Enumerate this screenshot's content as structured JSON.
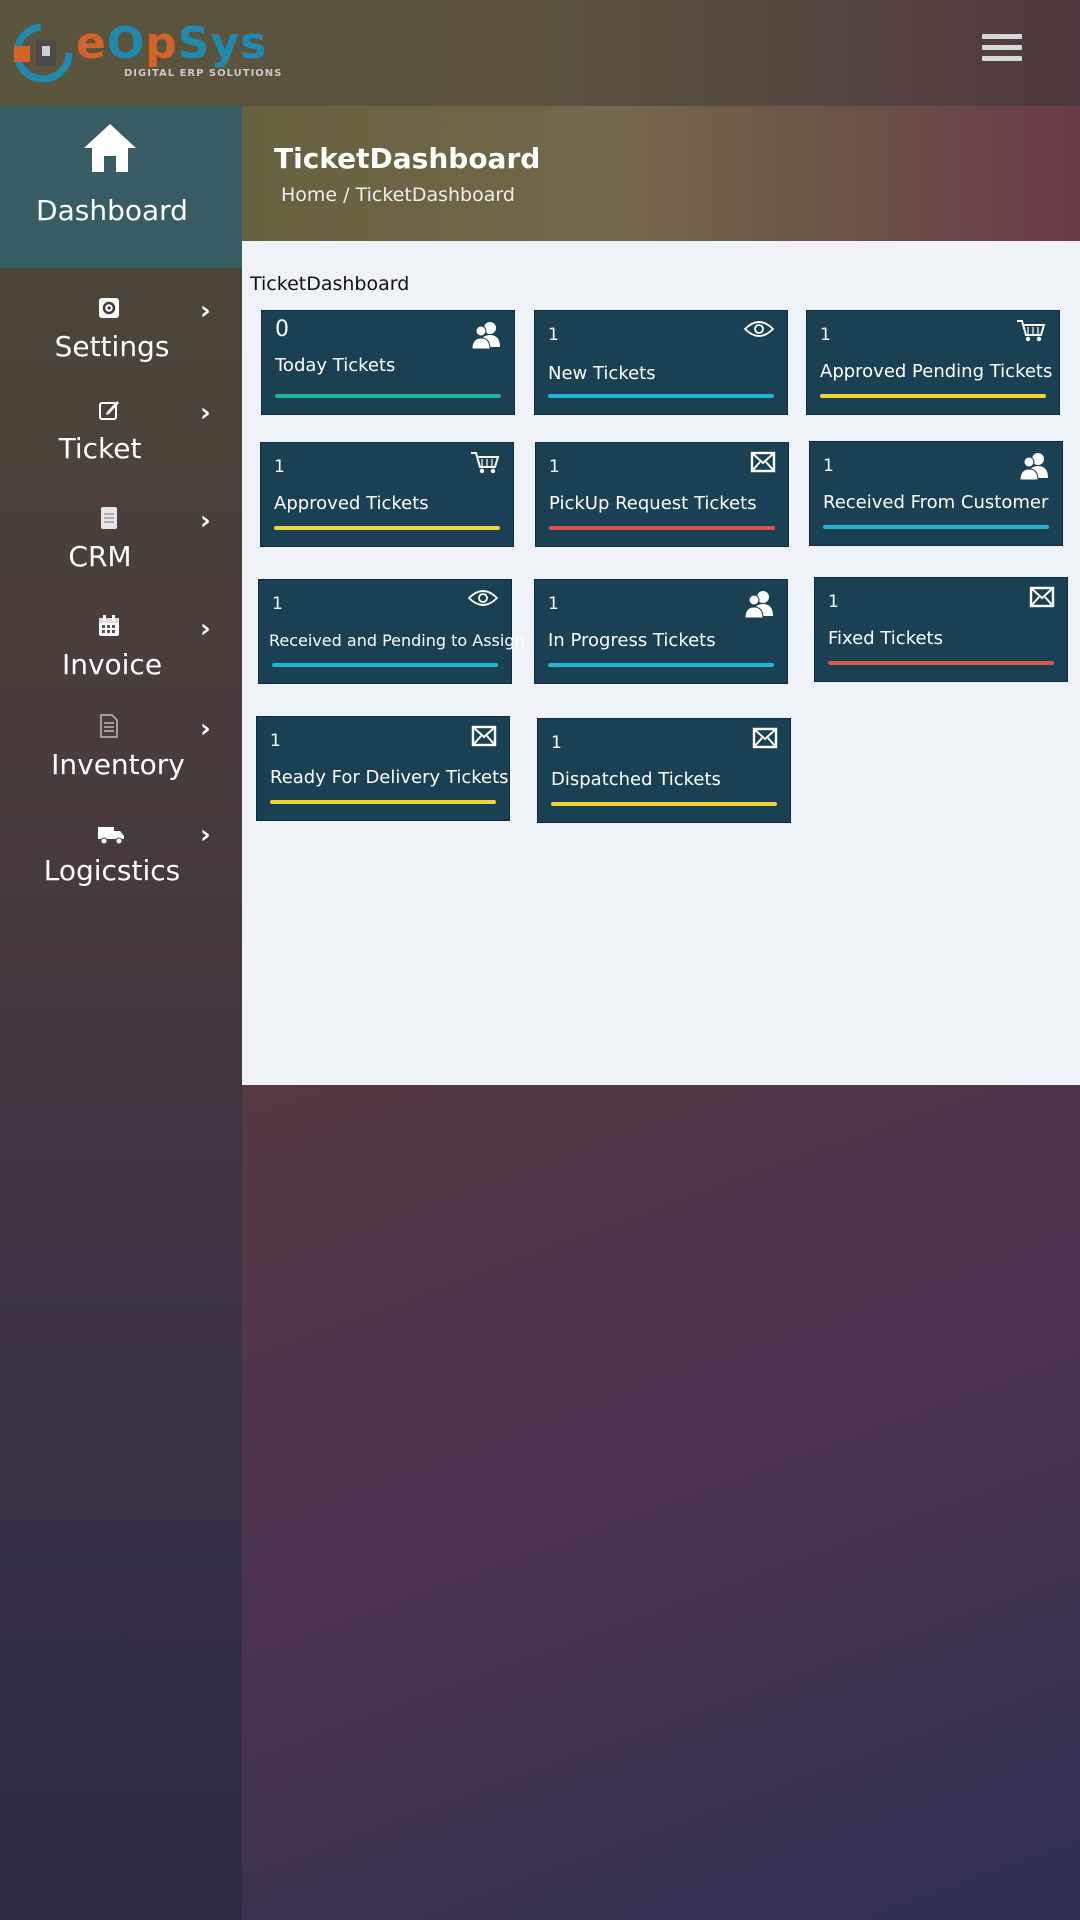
{
  "brand": {
    "name_part1": "e",
    "name_part2": "O",
    "name_part3": "p",
    "name_part4": "Sys",
    "tagline": "DIGITAL ERP SOLUTIONS",
    "colors": {
      "orange": "#d4632a",
      "blue": "#1f8ab0"
    }
  },
  "header": {
    "menu_icon": "hamburger-icon"
  },
  "sidebar": {
    "dashboard": {
      "label": "Dashboard",
      "icon": "home-icon"
    },
    "items": [
      {
        "label": "Settings",
        "icon": "gear-icon"
      },
      {
        "label": "Ticket",
        "icon": "edit-icon"
      },
      {
        "label": "CRM",
        "icon": "document-icon"
      },
      {
        "label": "Invoice",
        "icon": "calendar-icon"
      },
      {
        "label": "Inventory",
        "icon": "file-list-icon"
      },
      {
        "label": "Logicstics",
        "icon": "truck-icon"
      }
    ]
  },
  "page": {
    "title": "TicketDashboard",
    "breadcrumb_home": "Home",
    "breadcrumb_sep": "/",
    "breadcrumb_current": "TicketDashboard",
    "section_label": "TicketDashboard"
  },
  "cards": [
    {
      "count": "0",
      "title": "Today Tickets",
      "icon": "users-icon",
      "bar_color": "#21b39a"
    },
    {
      "count": "1",
      "title": "New Tickets",
      "icon": "eye-icon",
      "bar_color": "#1fb5d3"
    },
    {
      "count": "1",
      "title": "Approved Pending Tickets",
      "icon": "cart-icon",
      "bar_color": "#f2d43a"
    },
    {
      "count": "1",
      "title": "Approved Tickets",
      "icon": "cart-icon",
      "bar_color": "#f2d43a"
    },
    {
      "count": "1",
      "title": "PickUp Request Tickets",
      "icon": "envelope-icon",
      "bar_color": "#d9534f"
    },
    {
      "count": "1",
      "title": "Received From Customer",
      "icon": "users-icon",
      "bar_color": "#1fb5d3"
    },
    {
      "count": "1",
      "title": "Received and Pending to Assign",
      "icon": "eye-icon",
      "bar_color": "#1fb5d3"
    },
    {
      "count": "1",
      "title": "In Progress Tickets",
      "icon": "users-icon",
      "bar_color": "#1fb5d3"
    },
    {
      "count": "1",
      "title": "Fixed Tickets",
      "icon": "envelope-icon",
      "bar_color": "#d9534f"
    },
    {
      "count": "1",
      "title": "Ready For Delivery Tickets",
      "icon": "envelope-icon",
      "bar_color": "#f2d43a"
    },
    {
      "count": "1",
      "title": "Dispatched Tickets",
      "icon": "envelope-icon",
      "bar_color": "#f2d43a"
    }
  ]
}
